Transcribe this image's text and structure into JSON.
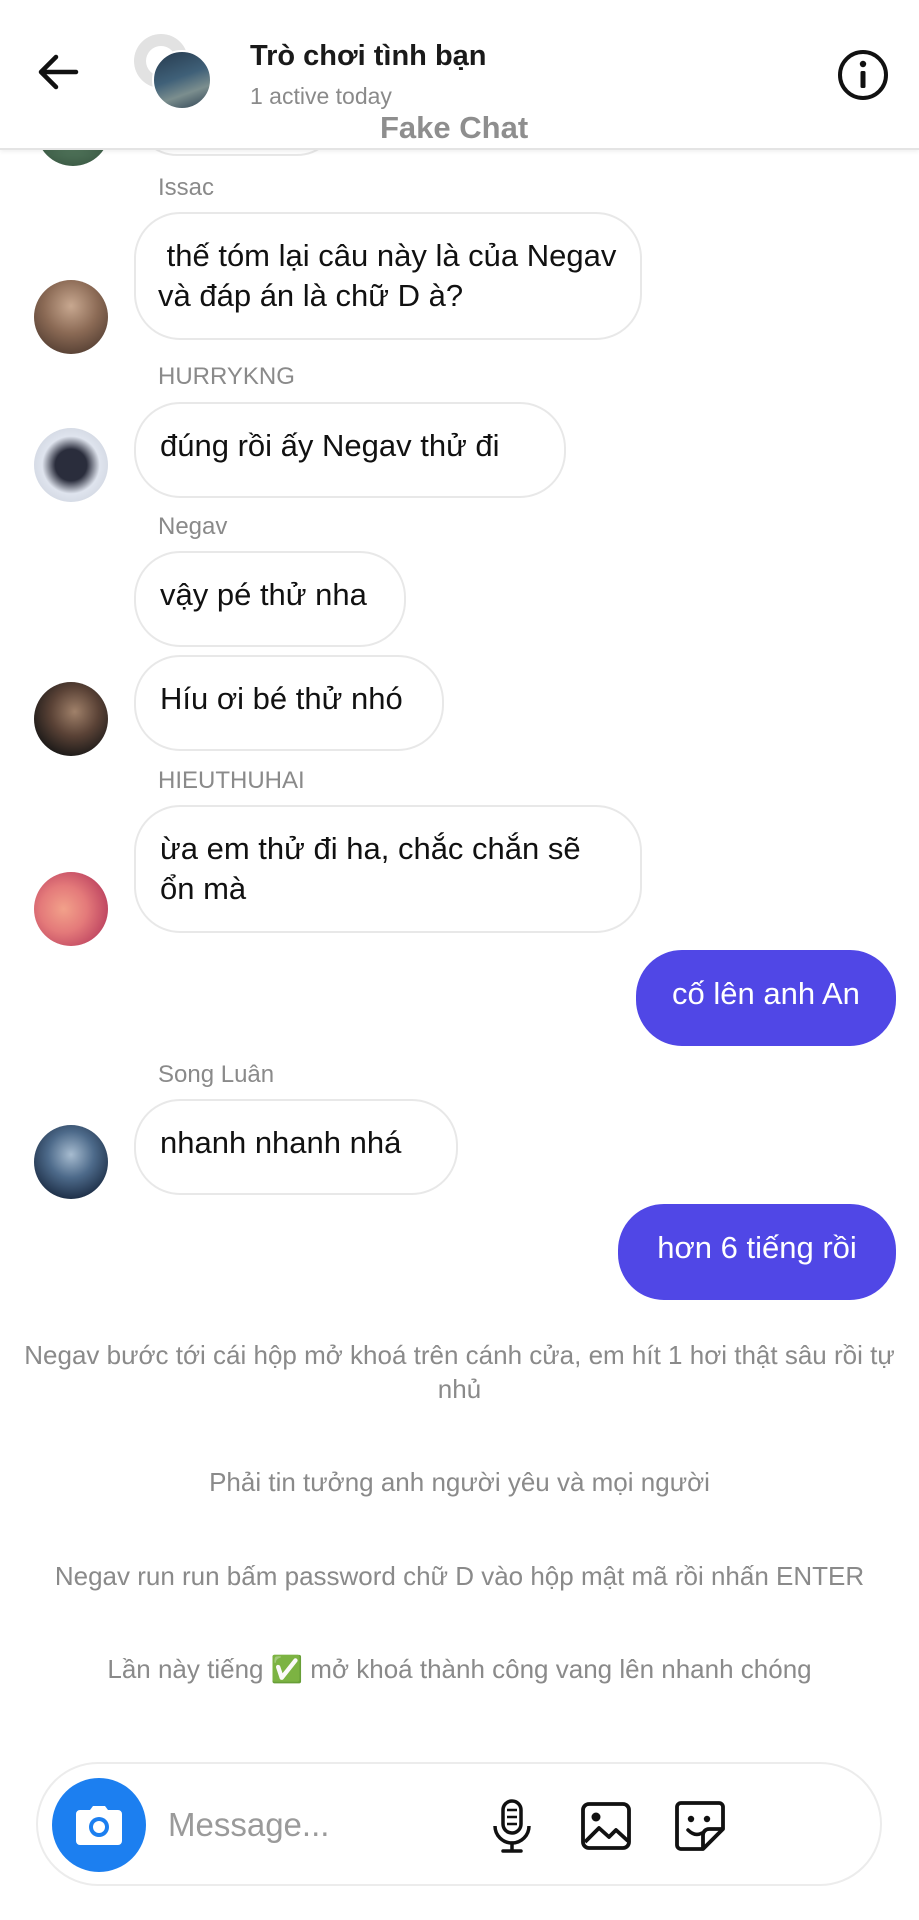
{
  "header": {
    "title": "Trò chơi tình bạn",
    "status": "1 active today",
    "watermark": "Fake Chat"
  },
  "messages": [
    {
      "sender": "Issac",
      "text": " thế tóm lại câu này là của Negav và đáp án là chữ D à?"
    },
    {
      "sender": "HURRYKNG",
      "text": "đúng rồi ấy Negav thử đi"
    },
    {
      "sender": "Negav",
      "text": "vậy pé thử nha"
    },
    {
      "sender": "",
      "text": "Híu ơi bé thử nhó"
    },
    {
      "sender": "HIEUTHUHAI",
      "text": "ừa em thử đi ha, chắc chắn sẽ ổn mà"
    },
    {
      "sender": "",
      "text": "cố lên anh An",
      "outgoing": true
    },
    {
      "sender": "Song Luân",
      "text": "nhanh nhanh nhá"
    },
    {
      "sender": "",
      "text": "hơn 6 tiếng rồi",
      "outgoing": true
    }
  ],
  "narrations": [
    "Negav bước tới cái hộp mở khoá trên cánh cửa, em hít 1 hơi thật sâu rồi tự nhủ",
    "Phải tin tưởng anh người yêu và mọi người",
    "Negav run run bấm password chữ D vào hộp mật mã rồi nhấn ENTER",
    "Lần này tiếng ✅ mở khoá thành công vang lên nhanh chóng"
  ],
  "composer": {
    "placeholder": "Message..."
  },
  "icons": {
    "back": "arrow-left-icon",
    "info": "info-icon",
    "camera": "camera-icon",
    "mic": "microphone-icon",
    "gallery": "image-icon",
    "sticker": "sticker-icon"
  },
  "colors": {
    "outgoing_bubble": "#5047e6",
    "camera_button": "#1c7ff0",
    "muted_text": "#8a8a8a"
  }
}
